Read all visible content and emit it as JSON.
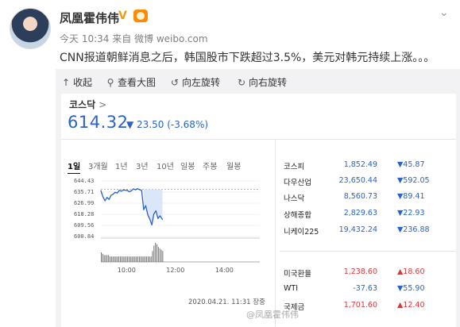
{
  "post": {
    "username": "凤凰霍伟伟",
    "verified_badge": "V",
    "time": "今天 10:34 来自 微博 weibo.com",
    "content": "CNN报道朝鲜消息之后，韩国股市下跌超过3.5%，美元对韩元持续上涨。。。",
    "watermark": "@凤凰霍伟伟"
  },
  "toolbar": {
    "collapse": "收起",
    "view_large": "查看大图",
    "rotate_left": "向左旋转",
    "rotate_right": "向右旋转"
  },
  "icons": [
    "arrow-up-icon",
    "search-icon",
    "rotate-left-icon",
    "rotate-right-icon",
    "chevron-down-icon",
    "verified-icon",
    "rank-badge-icon"
  ],
  "colors": {
    "up": "#e0353b",
    "down": "#2a62c9",
    "link": "#2a62c9"
  },
  "stock": {
    "name": "코스닥",
    "name_arrow": ">",
    "value": "614.32",
    "change": "▼ 23.50 (-3.68%)",
    "periods": [
      "1일",
      "3개월",
      "1년",
      "3년",
      "10년",
      "일봉",
      "주봉",
      "월봉"
    ],
    "active_period": "1일",
    "timestamp": "2020.04.21. 11:31 장중"
  },
  "quotes": [
    {
      "name": "코스피",
      "value": "1,852.49",
      "change": "▼45.87",
      "dir": "down"
    },
    {
      "name": "다우산업",
      "value": "23,650.44",
      "change": "▼592.05",
      "dir": "down"
    },
    {
      "name": "나스닥",
      "value": "8,560.73",
      "change": "▼89.41",
      "dir": "down"
    },
    {
      "name": "상해종합",
      "value": "2,829.63",
      "change": "▼22.93",
      "dir": "down"
    },
    {
      "name": "니케이225",
      "value": "19,432.24",
      "change": "▼236.88",
      "dir": "down"
    },
    {
      "name": "미국환율",
      "value": "1,238.60",
      "change": "▲18.60",
      "dir": "up"
    },
    {
      "name": "WTI",
      "value": "-37.63",
      "change": "▼55.90",
      "dir": "down"
    },
    {
      "name": "국제금",
      "value": "1,701.60",
      "change": "▲12.40",
      "dir": "up"
    }
  ],
  "chart_data": {
    "type": "line",
    "title": "",
    "xlabel": "",
    "ylabel": "",
    "y_ticks": [
      "644.43",
      "635.71",
      "626.99",
      "618.28",
      "609.56",
      "600.84"
    ],
    "x_ticks": [
      "10:00",
      "12:00",
      "14:00"
    ],
    "ylim": [
      600.84,
      644.43
    ],
    "x_range": [
      "09:00",
      "15:30"
    ],
    "previous_close": 637.82,
    "series": [
      {
        "x": [
          "09:00",
          "09:05",
          "09:10",
          "09:15",
          "09:20",
          "09:25",
          "09:30",
          "09:35",
          "09:40",
          "09:45",
          "09:50",
          "09:55",
          "10:00",
          "10:05",
          "10:10",
          "10:15",
          "10:20",
          "10:25",
          "10:30",
          "10:35",
          "10:40",
          "10:45",
          "10:50",
          "10:55",
          "11:00",
          "11:05",
          "11:10",
          "11:15",
          "11:20",
          "11:25",
          "11:31"
        ],
        "values": [
          636.8,
          632.0,
          628.9,
          631.5,
          630.0,
          633.2,
          634.1,
          635.5,
          635.0,
          637.0,
          636.5,
          637.3,
          637.2,
          637.0,
          636.0,
          636.8,
          638.2,
          637.5,
          638.4,
          637.6,
          637.0,
          622.0,
          625.0,
          618.0,
          614.5,
          610.0,
          618.5,
          621.0,
          615.0,
          617.0,
          614.32
        ]
      }
    ],
    "volume": [
      7,
      6,
      5,
      5,
      5,
      5,
      4,
      4,
      4,
      4,
      4,
      4,
      4,
      4,
      4,
      4,
      4,
      4,
      4,
      4,
      4,
      4,
      4,
      4,
      4,
      4,
      4,
      4,
      4,
      4,
      4,
      4,
      4,
      4,
      4,
      8,
      12,
      14,
      13,
      11,
      10,
      9,
      8
    ]
  }
}
